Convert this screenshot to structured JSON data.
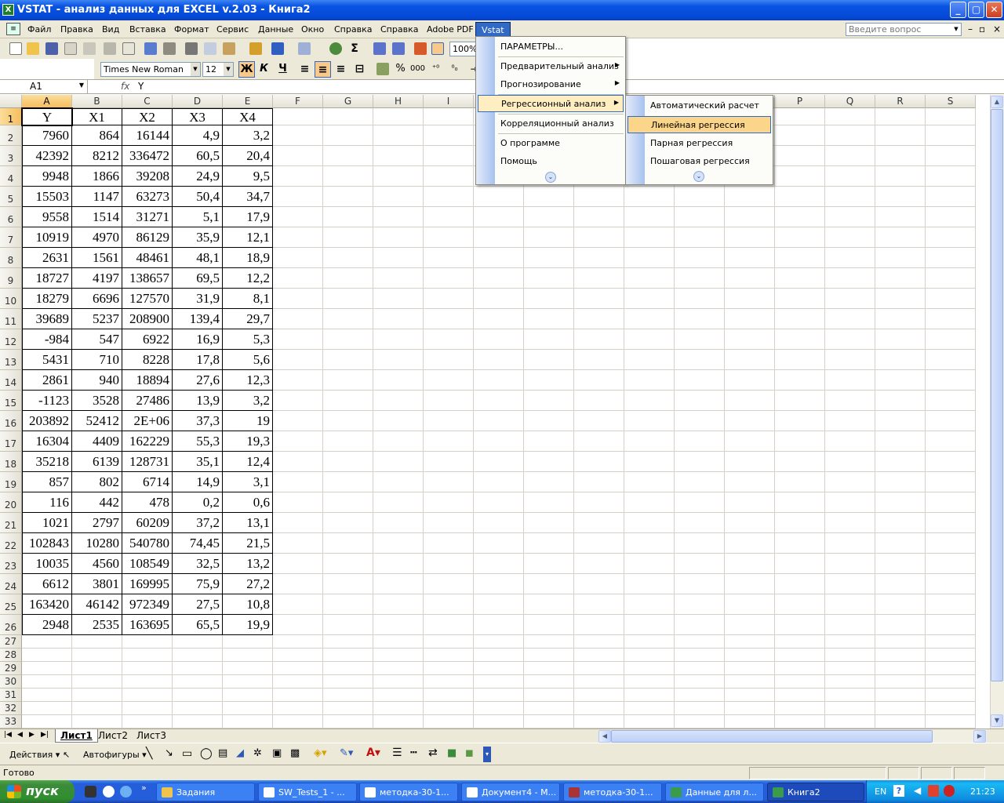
{
  "window": {
    "title": "VSTAT - анализ данных для EXCEL v.2.03 - Книга2",
    "app_icon": "excel-icon"
  },
  "menubar": {
    "items": [
      "Файл",
      "Правка",
      "Вид",
      "Вставка",
      "Формат",
      "Сервис",
      "Данные",
      "Окно",
      "Справка",
      "Справка",
      "Adobe PDF",
      "Vstat"
    ],
    "help_placeholder": "Введите вопрос"
  },
  "toolbar": {
    "zoom": "100%",
    "font_name": "Times New Roman",
    "font_size": "12",
    "bold": "Ж",
    "italic": "К",
    "underline": "Ч",
    "percent": "%",
    "thousands": "000"
  },
  "formula_bar": {
    "name_box": "A1",
    "fx": "fx",
    "value": "Y"
  },
  "sheet": {
    "columns": [
      "A",
      "B",
      "C",
      "D",
      "E",
      "F",
      "G",
      "H",
      "I",
      "J",
      "K",
      "L",
      "M",
      "N",
      "O",
      "P",
      "Q",
      "R",
      "S"
    ],
    "header_row": [
      "Y",
      "X1",
      "X2",
      "X3",
      "X4"
    ],
    "rows": [
      [
        "7960",
        "864",
        "16144",
        "4,9",
        "3,2"
      ],
      [
        "42392",
        "8212",
        "336472",
        "60,5",
        "20,4"
      ],
      [
        "9948",
        "1866",
        "39208",
        "24,9",
        "9,5"
      ],
      [
        "15503",
        "1147",
        "63273",
        "50,4",
        "34,7"
      ],
      [
        "9558",
        "1514",
        "31271",
        "5,1",
        "17,9"
      ],
      [
        "10919",
        "4970",
        "86129",
        "35,9",
        "12,1"
      ],
      [
        "2631",
        "1561",
        "48461",
        "48,1",
        "18,9"
      ],
      [
        "18727",
        "4197",
        "138657",
        "69,5",
        "12,2"
      ],
      [
        "18279",
        "6696",
        "127570",
        "31,9",
        "8,1"
      ],
      [
        "39689",
        "5237",
        "208900",
        "139,4",
        "29,7"
      ],
      [
        "-984",
        "547",
        "6922",
        "16,9",
        "5,3"
      ],
      [
        "5431",
        "710",
        "8228",
        "17,8",
        "5,6"
      ],
      [
        "2861",
        "940",
        "18894",
        "27,6",
        "12,3"
      ],
      [
        "-1123",
        "3528",
        "27486",
        "13,9",
        "3,2"
      ],
      [
        "203892",
        "52412",
        "2E+06",
        "37,3",
        "19"
      ],
      [
        "16304",
        "4409",
        "162229",
        "55,3",
        "19,3"
      ],
      [
        "35218",
        "6139",
        "128731",
        "35,1",
        "12,4"
      ],
      [
        "857",
        "802",
        "6714",
        "14,9",
        "3,1"
      ],
      [
        "116",
        "442",
        "478",
        "0,2",
        "0,6"
      ],
      [
        "1021",
        "2797",
        "60209",
        "37,2",
        "13,1"
      ],
      [
        "102843",
        "10280",
        "540780",
        "74,45",
        "21,5"
      ],
      [
        "10035",
        "4560",
        "108549",
        "32,5",
        "13,2"
      ],
      [
        "6612",
        "3801",
        "169995",
        "75,9",
        "27,2"
      ],
      [
        "163420",
        "46142",
        "972349",
        "27,5",
        "10,8"
      ],
      [
        "2948",
        "2535",
        "163695",
        "65,5",
        "19,9"
      ]
    ],
    "row_numbers": [
      "1",
      "2",
      "3",
      "4",
      "5",
      "6",
      "7",
      "8",
      "9",
      "10",
      "11",
      "12",
      "13",
      "14",
      "15",
      "16",
      "17",
      "18",
      "19",
      "20",
      "21",
      "22",
      "23",
      "24",
      "25",
      "26",
      "27",
      "28",
      "29",
      "30",
      "31",
      "32",
      "33"
    ]
  },
  "vstat_menu": {
    "items": [
      {
        "label": "ПАРАМЕТРЫ...",
        "submenu": false
      },
      {
        "label": "Предварительный анализ",
        "submenu": true
      },
      {
        "label": "Прогнозирование",
        "submenu": true
      },
      {
        "label": "Регрессионный анализ",
        "submenu": true
      },
      {
        "label": "Корреляционный анализ",
        "submenu": false
      },
      {
        "label": "О программе",
        "submenu": false
      },
      {
        "label": "Помощь",
        "submenu": false
      }
    ]
  },
  "regression_submenu": {
    "items": [
      "Автоматический расчет",
      "Линейная регрессия",
      "Парная регрессия",
      "Пошаговая регрессия"
    ]
  },
  "sheet_tabs": [
    "Лист1",
    "Лист2",
    "Лист3"
  ],
  "draw_toolbar": {
    "actions": "Действия",
    "autoshapes": "Автофигуры"
  },
  "status": {
    "text": "Готово"
  },
  "taskbar": {
    "start": "пуск",
    "tasks": [
      "Задания",
      "SW_Tests_1 - ...",
      "методка-30-1...",
      "Документ4 - М...",
      "методка-30-1...",
      "Данные для л...",
      "Книга2"
    ],
    "lang": "EN",
    "clock": "21:23"
  },
  "colors": {
    "title_blue": "#0a54e3",
    "menu_highlight": "#316ac5",
    "item_hover": "#ffeec2",
    "selected_header": "#f6bd5e"
  }
}
